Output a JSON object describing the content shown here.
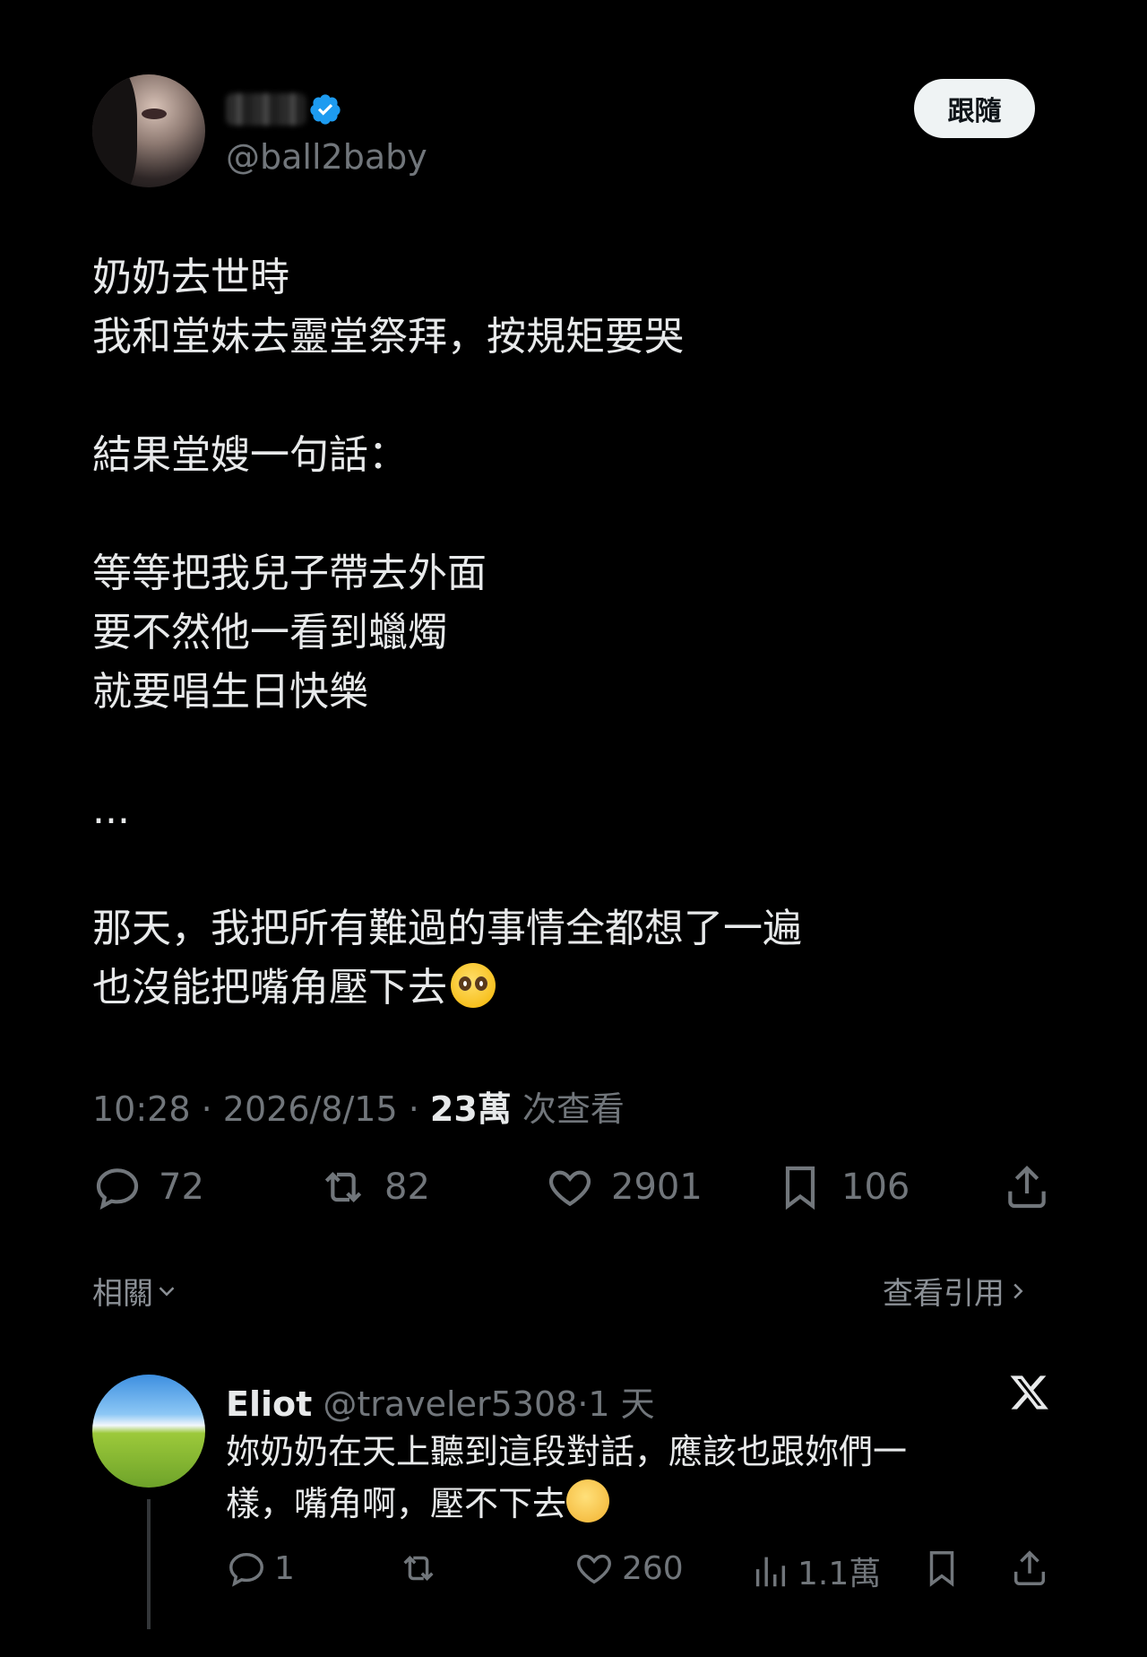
{
  "author": {
    "handle": "@ball2baby",
    "verified": true,
    "follow_label": "跟隨"
  },
  "tweet": {
    "lines": [
      "奶奶去世時",
      "我和堂妹去靈堂祭拜，按規矩要哭",
      "",
      "結果堂嫂一句話：",
      "",
      "等等把我兒子帶去外面",
      "要不然他一看到蠟燭",
      "就要唱生日快樂",
      "",
      "...",
      "",
      "那天，我把所有難過的事情全都想了一遍",
      "也沒能把嘴角壓下去"
    ],
    "trailing_emoji": "pleading-face"
  },
  "meta": {
    "time": "10:28",
    "date": "2026/8/15",
    "views_count": "23萬",
    "views_label": "次查看",
    "separator": "·"
  },
  "actions": {
    "replies": "72",
    "retweets": "82",
    "likes": "2901",
    "bookmarks": "106"
  },
  "related": {
    "label": "相關",
    "quotes_label": "查看引用"
  },
  "reply": {
    "name": "Eliot",
    "handle": "@traveler5308",
    "time": "1 天",
    "separator": "·",
    "text_line1": "妳奶奶在天上聽到這段對話，應該也跟妳們一",
    "text_line2": "樣，嘴角啊，壓不下去",
    "trailing_emoji": "smiling-face",
    "replies": "1",
    "likes": "260",
    "views": "1.1萬"
  },
  "colors": {
    "background": "#000000",
    "text": "#e7e9ea",
    "muted": "#71767b",
    "verified_blue": "#1d9bf0"
  }
}
